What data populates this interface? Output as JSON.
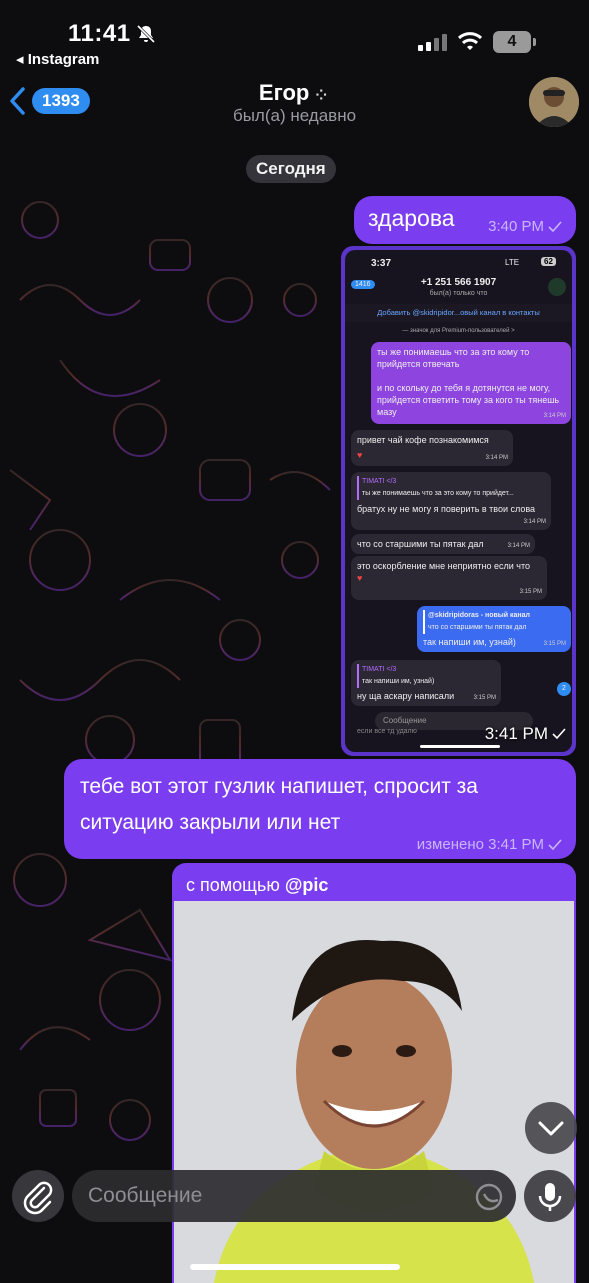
{
  "status_bar": {
    "time": "11:41",
    "back_app": "◂ Instagram",
    "battery": "4"
  },
  "header": {
    "unread_count": "1393",
    "contact_name": "Егор",
    "contact_status": "был(а) недавно"
  },
  "chat": {
    "date_label": "Сегодня",
    "messages": [
      {
        "text": "здарова",
        "time": "3:40 PM"
      },
      {
        "time": "3:41 PM"
      },
      {
        "text": "тебе вот этот гузлик напишет, спросит за ситуацию закрыли или нет",
        "time": "изменено 3:41 PM"
      },
      {
        "caption_prefix": "с помощью ",
        "caption_handle": "@pic"
      }
    ]
  },
  "screenshot": {
    "time": "3:37",
    "network": "LTE",
    "battery": "62",
    "unread": "1416",
    "phone": "+1 251 566 1907",
    "seen": "был(а) только что",
    "banner": "Добавить @skidripidor...овый канал в контакты",
    "premium": "— значок для Premium-пользователей >",
    "m1": "ты же понимаешь что за это кому то прийдется отвечать",
    "m1b": "и по скольку до тебя я дотянутся не могу, прийдется ответить тому за кого ты тянешь мазу",
    "m1_time": "3:14 PM",
    "m2": "привет чай кофе познакомимся",
    "m2_time": "3:14 PM",
    "m3_reply_name": "TIMATI </3",
    "m3_reply": "ты же понимаешь что за это кому то прийдет...",
    "m3": "братух ну не могу я поверить в твои слова",
    "m3_time": "3:14 PM",
    "m4": "что со старшими ты пятак дал",
    "m4_time": "3:14 PM",
    "m5": "это оскорбление мне неприятно если что",
    "m5_time": "3:15 PM",
    "m6_reply_name": "@skidripidoras - новый канал",
    "m6_reply": "что со старшими ты пятак дал",
    "m6": "так напиши им, узнай)",
    "m6_time": "3:15 PM",
    "m7_reply_name": "TIMATI </3",
    "m7_reply": "так напиши им, узнай)",
    "m7": "ну ща аскару написали",
    "m7_time": "3:15 PM",
    "m8": "если все тд удалю",
    "scroll_badge": "2",
    "input_placeholder": "Сообщение"
  },
  "composer": {
    "placeholder": "Сообщение"
  }
}
